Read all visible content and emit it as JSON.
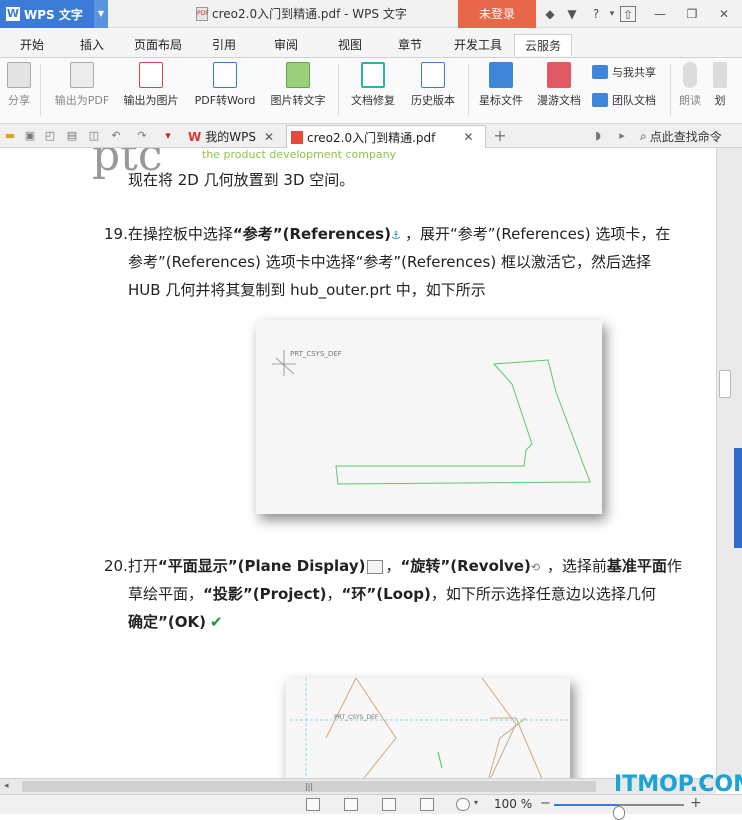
{
  "titlebar": {
    "app_name": "WPS 文字",
    "doc_title": "creo2.0入门到精通.pdf - WPS 文字",
    "login": "未登录"
  },
  "menu": {
    "tabs": [
      "开始",
      "插入",
      "页面布局",
      "引用",
      "审阅",
      "视图",
      "章节",
      "开发工具",
      "云服务"
    ],
    "active": "云服务"
  },
  "ribbon": {
    "share": "分享",
    "export_pdf": "输出为PDF",
    "export_image": "输出为图片",
    "pdf_to_word": "PDF转Word",
    "image_to_text": "图片转文字",
    "doc_repair": "文档修复",
    "history": "历史版本",
    "starred": "星标文件",
    "roaming": "漫游文档",
    "shared_with_me": "与我共享",
    "team_docs": "团队文档",
    "read_aloud": "朗读",
    "more": "划"
  },
  "tabs": {
    "my_wps": "我的WPS",
    "document": "creo2.0入门到精通.pdf",
    "find_command": "点此查找命令"
  },
  "document": {
    "header_banner": "the product development company",
    "line0": "现在将 2D 几何放置到 3D 空间。",
    "step19_num": "19.",
    "step19_a": "在操控板中选择",
    "step19_b": "“参考”(References)",
    "step19_c": "，展开“参考”(References) 选项卡，在",
    "step19_line2": "参考”(References) 选项卡中选择“参考”(References) 框以激活它，然后选择",
    "step19_line3": "HUB 几何并将其复制到 hub_outer.prt 中，如下所示",
    "fig1_label": "PRT_CSYS_DEF",
    "step20_num": "20.",
    "step20_a": "打开",
    "step20_b": "“平面显示”(Plane Display)",
    "step20_c": "，",
    "step20_d": "“旋转”(Revolve)",
    "step20_e": "，选择前",
    "step20_f": "基准平面",
    "step20_g": "作",
    "step20_line2a": "草绘平面，",
    "step20_line2b": "“投影”(Project)",
    "step20_line2c": "，",
    "step20_line2d": "“环”(Loop)",
    "step20_line2e": "，如下所示选择任意边以选择几何",
    "step20_line3a": "确定”(OK)",
    "fig2_label": "PRT_CSYS_DEF"
  },
  "statusbar": {
    "zoom": "100 %",
    "zoom_fraction": 0.5
  },
  "watermark": "ITMOP.COM",
  "colors": {
    "brand": "#3b7bd6",
    "login": "#e8664a",
    "sketch_green": "#5fc76a",
    "watermark": "#1aa3d4"
  }
}
